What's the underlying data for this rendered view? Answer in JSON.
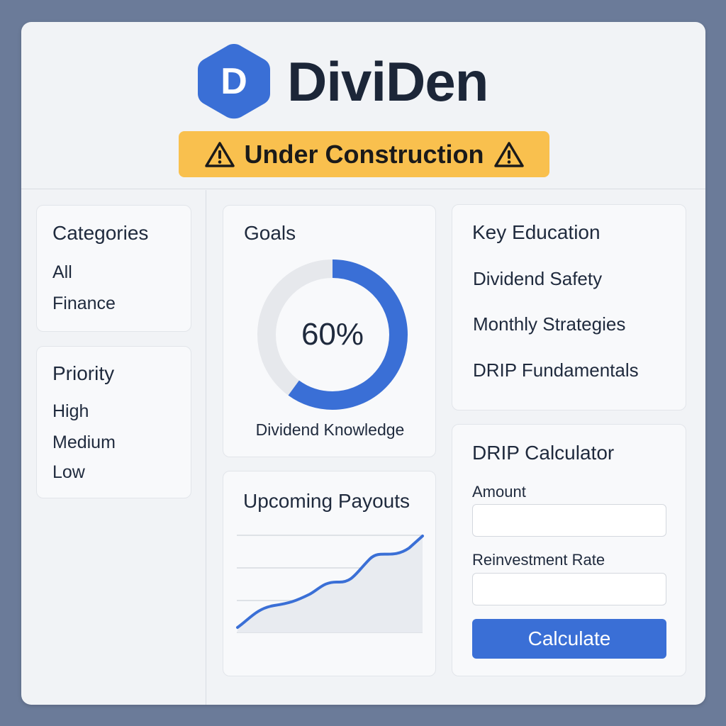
{
  "app": {
    "title": "DiviDen",
    "logo_letter": "D",
    "accent": "#3a6fd6",
    "banner": {
      "text": "Under Construction",
      "color": "#f9c04e",
      "icon": "warning-icon"
    }
  },
  "sidebar": {
    "categories": {
      "title": "Categories",
      "items": [
        "All",
        "Finance"
      ]
    },
    "priority": {
      "title": "Priority",
      "items": [
        "High",
        "Medium",
        "Low"
      ]
    }
  },
  "goals": {
    "title": "Goals",
    "progress": 0.6,
    "progress_label": "60%",
    "caption": "Dividend Knowledge"
  },
  "payouts": {
    "title": "Upcoming Payouts"
  },
  "education": {
    "title": "Key Education",
    "items": [
      "Dividend Safety",
      "Monthly Strategies",
      "DRIP Fundamentals"
    ]
  },
  "calculator": {
    "title": "DRIP Calculator",
    "amount_label": "Amount",
    "amount_value": "",
    "rate_label": "Reinvestment Rate",
    "rate_value": "",
    "button_label": "Calculate"
  }
}
